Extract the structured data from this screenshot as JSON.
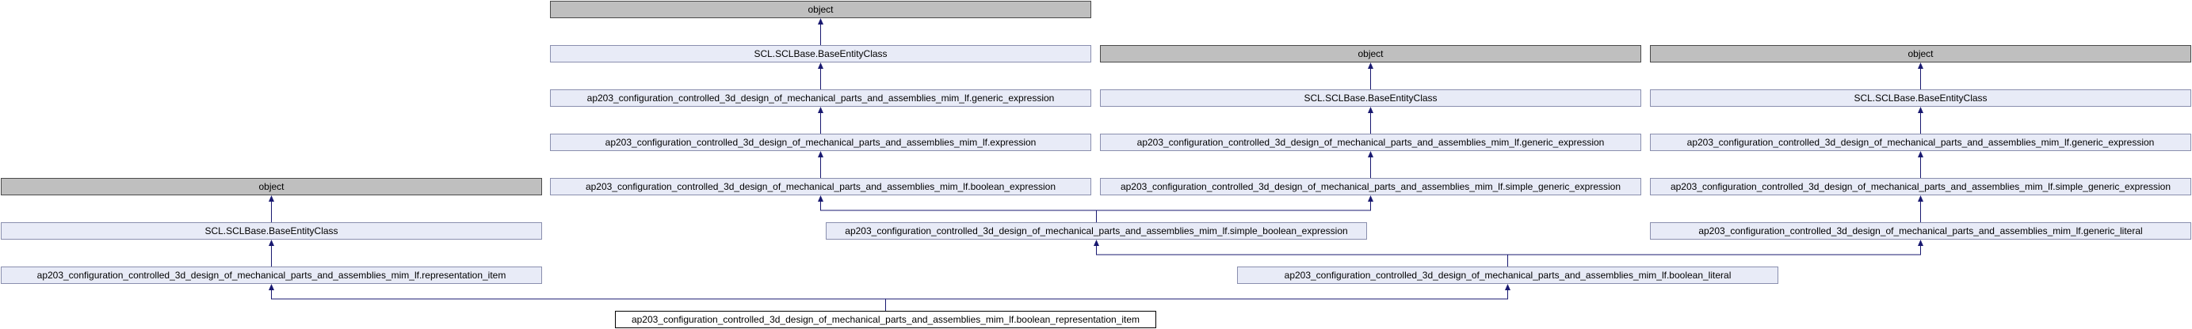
{
  "diagram": {
    "nodes": [
      {
        "id": "obj_a",
        "label": "object",
        "kind": "object"
      },
      {
        "id": "base_a",
        "label": "SCL.SCLBase.BaseEntityClass",
        "kind": "class"
      },
      {
        "id": "gen_expr_a",
        "label": "ap203_configuration_controlled_3d_design_of_mechanical_parts_and_assemblies_mim_lf.generic_expression",
        "kind": "class"
      },
      {
        "id": "expr",
        "label": "ap203_configuration_controlled_3d_design_of_mechanical_parts_and_assemblies_mim_lf.expression",
        "kind": "class"
      },
      {
        "id": "bool_expr",
        "label": "ap203_configuration_controlled_3d_design_of_mechanical_parts_and_assemblies_mim_lf.boolean_expression",
        "kind": "class"
      },
      {
        "id": "obj_b",
        "label": "object",
        "kind": "object"
      },
      {
        "id": "base_b",
        "label": "SCL.SCLBase.BaseEntityClass",
        "kind": "class"
      },
      {
        "id": "gen_expr_b",
        "label": "ap203_configuration_controlled_3d_design_of_mechanical_parts_and_assemblies_mim_lf.generic_expression",
        "kind": "class"
      },
      {
        "id": "simple_gen_b",
        "label": "ap203_configuration_controlled_3d_design_of_mechanical_parts_and_assemblies_mim_lf.simple_generic_expression",
        "kind": "class"
      },
      {
        "id": "obj_c",
        "label": "object",
        "kind": "object"
      },
      {
        "id": "base_c",
        "label": "SCL.SCLBase.BaseEntityClass",
        "kind": "class"
      },
      {
        "id": "gen_expr_c",
        "label": "ap203_configuration_controlled_3d_design_of_mechanical_parts_and_assemblies_mim_lf.generic_expression",
        "kind": "class"
      },
      {
        "id": "simple_gen_c",
        "label": "ap203_configuration_controlled_3d_design_of_mechanical_parts_and_assemblies_mim_lf.simple_generic_expression",
        "kind": "class"
      },
      {
        "id": "obj_d",
        "label": "object",
        "kind": "object"
      },
      {
        "id": "base_d",
        "label": "SCL.SCLBase.BaseEntityClass",
        "kind": "class"
      },
      {
        "id": "rep_item",
        "label": "ap203_configuration_controlled_3d_design_of_mechanical_parts_and_assemblies_mim_lf.representation_item",
        "kind": "class"
      },
      {
        "id": "simple_bool",
        "label": "ap203_configuration_controlled_3d_design_of_mechanical_parts_and_assemblies_mim_lf.simple_boolean_expression",
        "kind": "class"
      },
      {
        "id": "gen_literal",
        "label": "ap203_configuration_controlled_3d_design_of_mechanical_parts_and_assemblies_mim_lf.generic_literal",
        "kind": "class"
      },
      {
        "id": "bool_literal",
        "label": "ap203_configuration_controlled_3d_design_of_mechanical_parts_and_assemblies_mim_lf.boolean_literal",
        "kind": "class"
      },
      {
        "id": "bool_rep_item",
        "label": "ap203_configuration_controlled_3d_design_of_mechanical_parts_and_assemblies_mim_lf.boolean_representation_item",
        "kind": "target"
      }
    ],
    "edges": [
      {
        "from": "base_a",
        "to": "obj_a"
      },
      {
        "from": "gen_expr_a",
        "to": "base_a"
      },
      {
        "from": "expr",
        "to": "gen_expr_a"
      },
      {
        "from": "bool_expr",
        "to": "expr"
      },
      {
        "from": "base_b",
        "to": "obj_b"
      },
      {
        "from": "gen_expr_b",
        "to": "base_b"
      },
      {
        "from": "simple_gen_b",
        "to": "gen_expr_b"
      },
      {
        "from": "base_c",
        "to": "obj_c"
      },
      {
        "from": "gen_expr_c",
        "to": "base_c"
      },
      {
        "from": "simple_gen_c",
        "to": "gen_expr_c"
      },
      {
        "from": "base_d",
        "to": "obj_d"
      },
      {
        "from": "rep_item",
        "to": "base_d"
      },
      {
        "from": "simple_bool",
        "to": "bool_expr"
      },
      {
        "from": "simple_bool",
        "to": "simple_gen_b"
      },
      {
        "from": "gen_literal",
        "to": "simple_gen_c"
      },
      {
        "from": "bool_literal",
        "to": "simple_bool"
      },
      {
        "from": "bool_literal",
        "to": "gen_literal"
      },
      {
        "from": "bool_rep_item",
        "to": "rep_item"
      },
      {
        "from": "bool_rep_item",
        "to": "bool_literal"
      }
    ]
  }
}
